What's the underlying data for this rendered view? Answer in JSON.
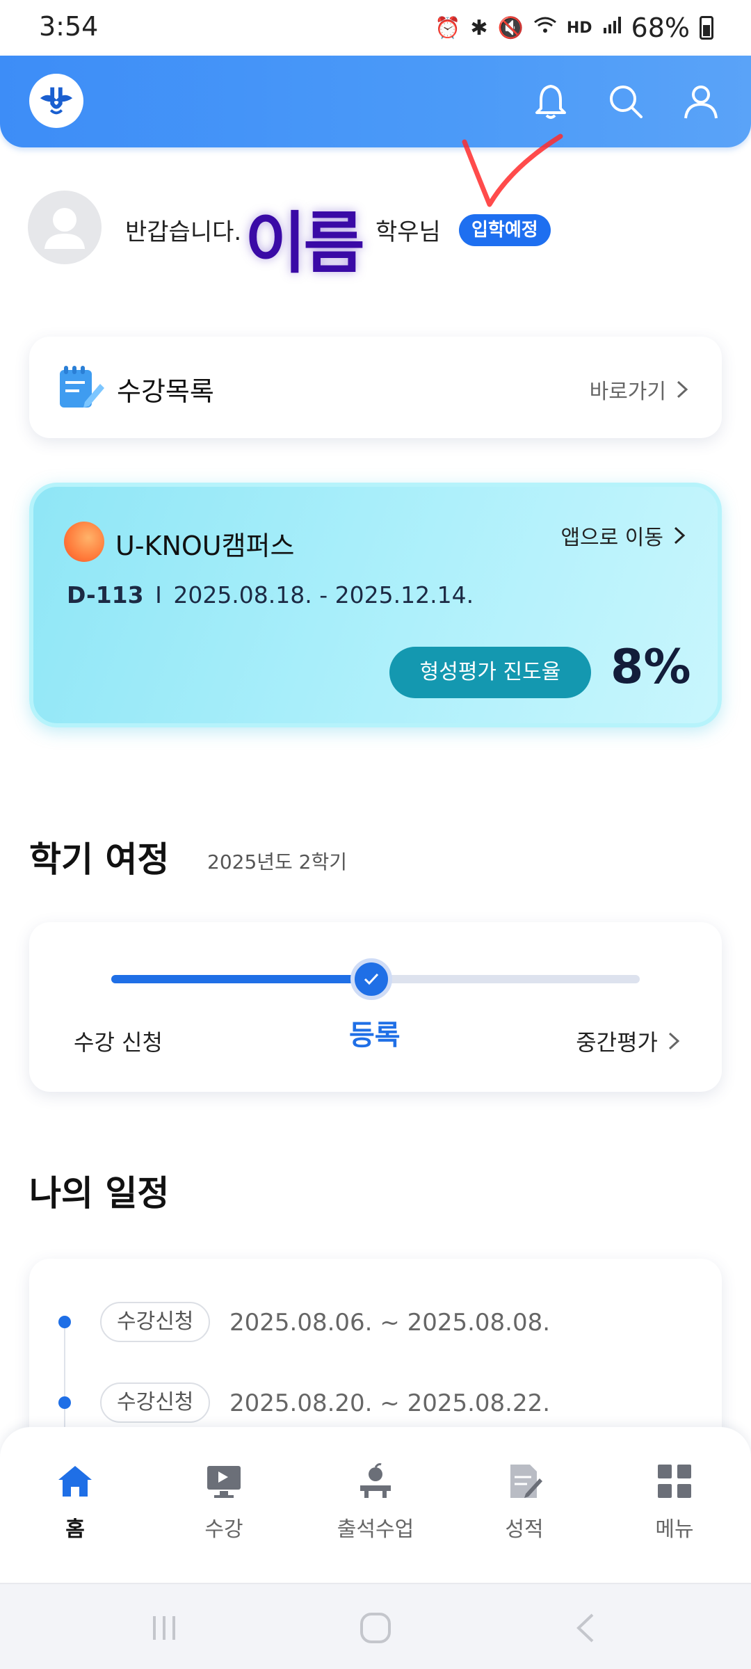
{
  "status_bar": {
    "time": "3:54",
    "network": "HD",
    "battery": "68%"
  },
  "header": {
    "icons": [
      "bell-icon",
      "search-icon",
      "user-icon"
    ],
    "brand_color": "#4b9af8"
  },
  "greeting": {
    "prefix": "반갑습니다.",
    "name": "이름",
    "suffix": "학우님",
    "badge": "입학예정"
  },
  "course_list": {
    "title": "수강목록",
    "link": "바로가기"
  },
  "campus": {
    "title": "U-KNOU캠퍼스",
    "link": "앱으로 이동",
    "dday": "D-113",
    "separator": "I",
    "period": "2025.08.18. - 2025.12.14.",
    "progress_label": "형성평가 진도율",
    "progress_value": "8%"
  },
  "journey": {
    "title": "학기 여정",
    "subtitle": "2025년도 2학기",
    "stage_previous": "수강 신청",
    "stage_current": "등록",
    "stage_next": "중간평가",
    "progress_fraction": 0.5
  },
  "schedule": {
    "title": "나의 일정",
    "items": [
      {
        "tag": "수강신청",
        "date": "2025.08.06. ~ 2025.08.08."
      },
      {
        "tag": "수강신청",
        "date": "2025.08.20. ~ 2025.08.22."
      }
    ]
  },
  "bottom_nav": {
    "items": [
      {
        "label": "홈",
        "icon": "home-icon",
        "active": true
      },
      {
        "label": "수강",
        "icon": "lecture-icon",
        "active": false
      },
      {
        "label": "출석수업",
        "icon": "attendance-class-icon",
        "active": false
      },
      {
        "label": "성적",
        "icon": "grades-icon",
        "active": false
      },
      {
        "label": "메뉴",
        "icon": "menu-grid-icon",
        "active": false
      }
    ],
    "active_color": "#1f6fe6"
  }
}
